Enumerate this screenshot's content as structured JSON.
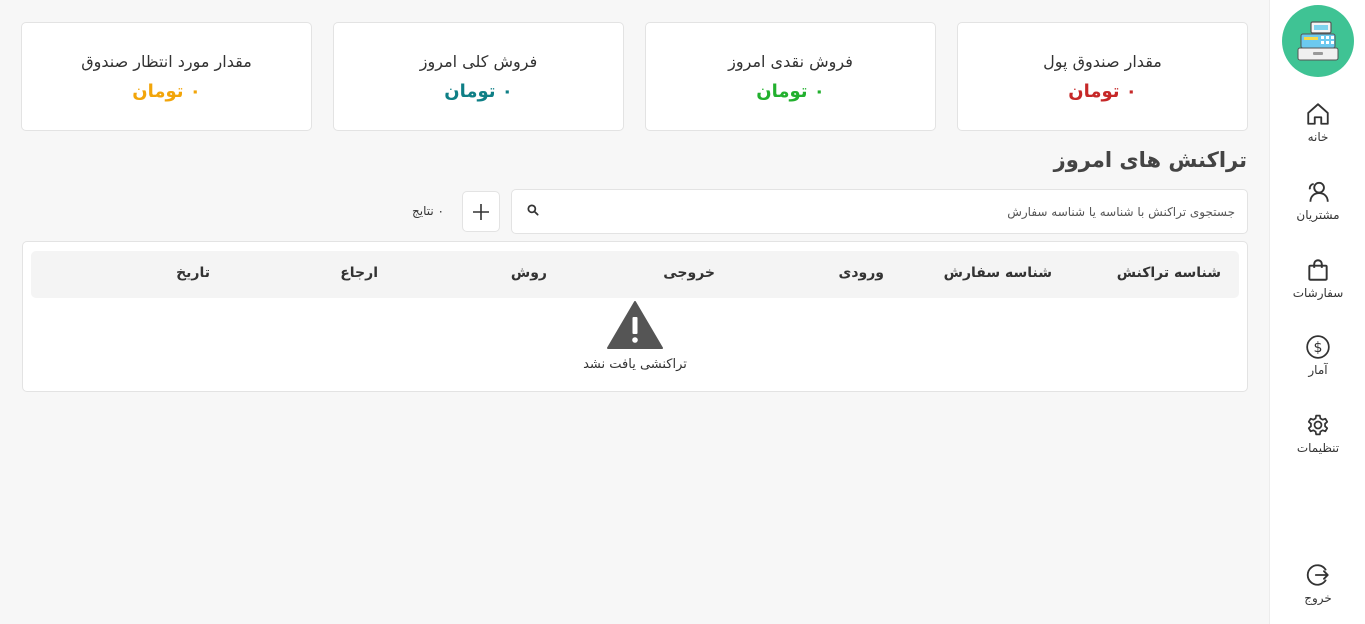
{
  "sidebar": {
    "items": [
      {
        "label": "خانه",
        "icon": "home-icon"
      },
      {
        "label": "مشتریان",
        "icon": "users-icon"
      },
      {
        "label": "سفارشات",
        "icon": "shopping-bag-icon"
      },
      {
        "label": "آمار",
        "icon": "dollar-icon"
      },
      {
        "label": "تنظیمات",
        "icon": "gear-icon"
      }
    ],
    "logout_label": "خروج"
  },
  "cards": [
    {
      "title": "مقدار صندوق پول",
      "value": "۰ تومان",
      "color": "#c62828"
    },
    {
      "title": "فروش نقدی امروز",
      "value": "۰ تومان",
      "color": "#22b02e"
    },
    {
      "title": "فروش کلی امروز",
      "value": "۰ تومان",
      "color": "#0e7f86"
    },
    {
      "title": "مقدار مورد انتظار صندوق",
      "value": "۰ تومان",
      "color": "#f2a50a"
    }
  ],
  "transactions": {
    "title": "تراکنش های امروز",
    "search_placeholder": "جستجوی تراکنش با شناسه یا شناسه سفارش",
    "results_label": "۰ نتایج",
    "columns": [
      "شناسه تراکنش",
      "شناسه سفارش",
      "ورودی",
      "خروجی",
      "روش",
      "ارجاع",
      "تاریخ"
    ],
    "empty_message": "تراکنشی یافت نشد"
  }
}
